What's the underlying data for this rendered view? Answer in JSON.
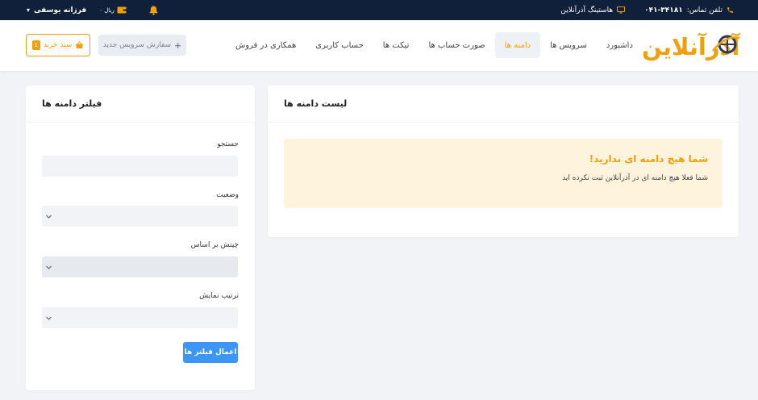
{
  "topbar": {
    "phone_label": "تلفن تماس:",
    "phone_number": "۰۴۱-۳۴۱۸۱",
    "hosting_label": "هاستینگ آذرآنلاین",
    "user_name": "فرزانه یوسفی",
    "wallet_amount": "۰ ریال"
  },
  "header": {
    "logo_text": "آذرآنلاین",
    "nav": [
      {
        "label": "داشبورد",
        "active": false
      },
      {
        "label": "سرویس ها",
        "active": false
      },
      {
        "label": "دامنه ها",
        "active": true
      },
      {
        "label": "صورت حساب ها",
        "active": false
      },
      {
        "label": "تیکت ها",
        "active": false
      },
      {
        "label": "حساب کاربری",
        "active": false
      },
      {
        "label": "همکاری در فروش",
        "active": false
      }
    ],
    "new_order_label": "سفارش سرویس جدید",
    "cart_label": "سبد خرید",
    "cart_count": "1"
  },
  "domain_list": {
    "title": "لیست دامنه ها",
    "empty_title": "شما هیچ دامنه ای ندارید!",
    "empty_text": "شما فعلا هیچ دامنه ای در آذرآنلاین ثبت نکرده اید"
  },
  "filter": {
    "title": "فیلتر دامنه ها",
    "search_label": "جستجو",
    "search_value": "",
    "status_label": "وضعیت",
    "status_value": "",
    "sort_label": "چینش بر اساس",
    "sort_value": "",
    "order_label": "ترتیب نمایش",
    "order_value": "",
    "apply_label": "اعمال فیلتر ها"
  },
  "colors": {
    "accent": "#f0a00c",
    "topbar": "#10203a",
    "primary_button": "#3d96f5",
    "alert_bg": "#fef3dc"
  }
}
